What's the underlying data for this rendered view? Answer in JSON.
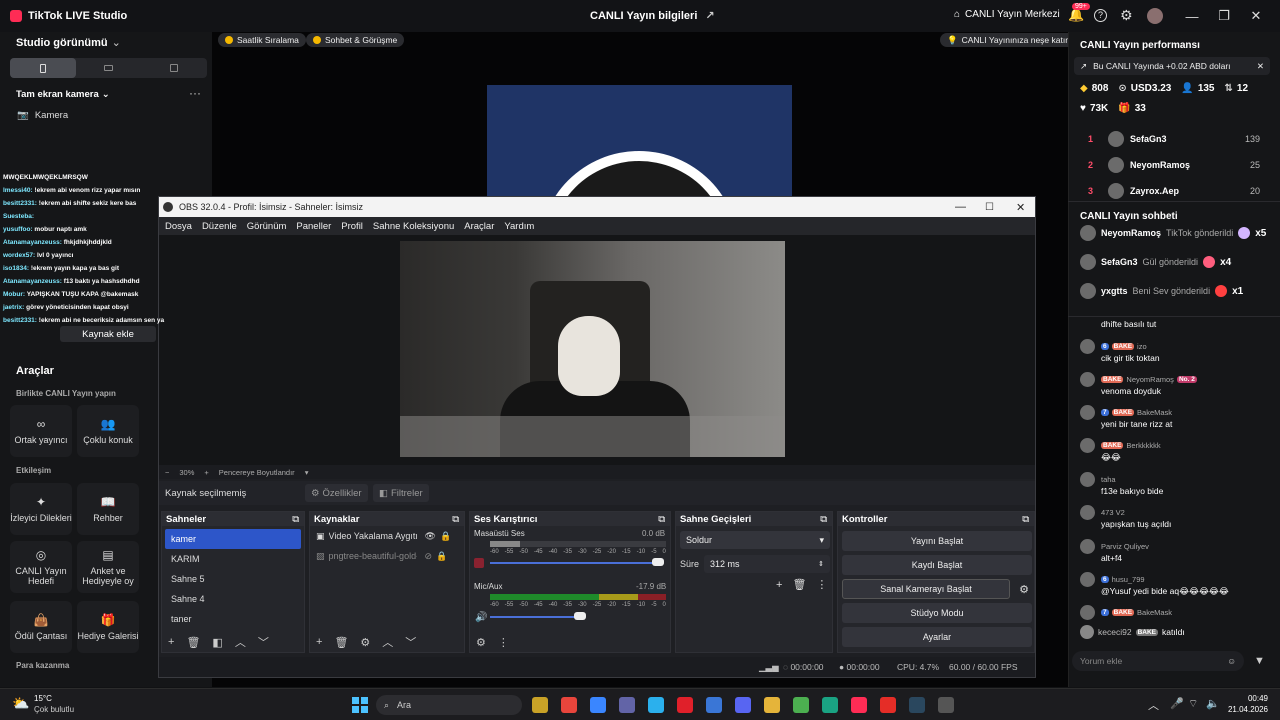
{
  "tiktok": {
    "app_title": "TikTok LIVE Studio",
    "center_title": "CANLI Yayın bilgileri",
    "live_center": "CANLI Yayın Merkezi",
    "notif_count": "99+"
  },
  "left_panel": {
    "studio_view": "Studio görünümü",
    "fullscreen_camera": "Tam ekran kamera",
    "camera": "Kamera",
    "add_source": "Kaynak ekle",
    "tools_title": "Araçlar",
    "together_live": "Birlikte CANLI Yayın yapın",
    "cohost": "Ortak yayıncı",
    "multi_guest": "Çoklu konuk",
    "interaction": "Etkileşim",
    "liked_viewers": "İzleyici Dilekleri",
    "guide": "Rehber",
    "live_goal": "CANLI Yayın Hedefi",
    "poll_wishlist": "Anket ve Hediyeyle oy",
    "reward_bag": "Ödül Çantası",
    "gift_gallery": "Hediye Galerisi",
    "monetization": "Para kazanma",
    "chat_overlay": [
      {
        "user": "",
        "text": "MWQEKLMWQEKLMRSQW"
      },
      {
        "user": "lmessi40:",
        "text": "!ekrem abi venom rizz yapar mısın"
      },
      {
        "user": "besitt2331:",
        "text": "!ekrem abi shifte sekiz kere bas"
      },
      {
        "user": "Suesteba:",
        "text": ""
      },
      {
        "user": "yusuffoo:",
        "text": "mobur naptı amk"
      },
      {
        "user": "Atanamayanzeuss:",
        "text": "fhkjdhkjhddjkld"
      },
      {
        "user": "wordex57:",
        "text": "lvl 0 yayıncı"
      },
      {
        "user": "iso1834:",
        "text": "!ekrem yayın kapa ya bas git"
      },
      {
        "user": "Atanamayanzeuss:",
        "text": "f13 baktı ya hashsdhdhd"
      },
      {
        "user": "Mobur:",
        "text": "YAPIŞKAN TUŞU KAPA @bakemask"
      },
      {
        "user": "jaetrix:",
        "text": "görev yöneticisinden kapat obsyi"
      },
      {
        "user": "besitt2331:",
        "text": "!ekrem abi ne beceriksiz adamsın sen ya"
      }
    ]
  },
  "stage": {
    "pill1": "Saatlik Sıralama",
    "pill2": "Sohbet & Görüşme",
    "pill3": "CANLI Yayınınıza neşe katın"
  },
  "right_panel": {
    "performance_title": "CANLI Yayın performansı",
    "earning_banner": "Bu CANLI Yayında +0.02 ABD doları",
    "stats": {
      "diamonds": "808",
      "usd": "USD3.23",
      "viewers": "135",
      "rank": "12",
      "likes": "73K",
      "gifts": "33"
    },
    "ranking": [
      {
        "n": "1",
        "name": "SefaGn3",
        "score": "139"
      },
      {
        "n": "2",
        "name": "NeyomRamoş",
        "score": "25"
      },
      {
        "n": "3",
        "name": "Zayrox.Aep",
        "score": "20"
      }
    ],
    "chat_title": "CANLI Yayın sohbeti",
    "gifts": [
      {
        "user": "NeyomRamoş",
        "action": "TikTok gönderildi",
        "count": "x5"
      },
      {
        "user": "SefaGn3",
        "action": "Gül gönderildi",
        "count": "x4"
      },
      {
        "user": "yxgtts",
        "action": "Beni Sev gönderildi",
        "count": "x1"
      }
    ],
    "messages": [
      {
        "meta_user": "",
        "badge": "",
        "badge_label": "",
        "text": "dhifte basılı tut"
      },
      {
        "meta_user": "izo",
        "badge": "6",
        "badge_label": "BAKE",
        "text": "cik gir tik toktan"
      },
      {
        "meta_user": "NeyomRamoş",
        "badge": "",
        "badge_label": "BAKE",
        "extra": "No. 2",
        "text": "venoma doyduk"
      },
      {
        "meta_user": "BakeMask",
        "badge": "7",
        "badge_label": "BAKE",
        "text": "yeni bir tane rizz at"
      },
      {
        "meta_user": "Berkkkkkk",
        "badge": "",
        "badge_label": "BAKE",
        "text": "😂😂"
      },
      {
        "meta_user": "taha",
        "badge": "",
        "badge_label": "",
        "text": "f13e bakıyo bide"
      },
      {
        "meta_user": "473 V2",
        "badge": "",
        "badge_label": "",
        "text": "yapışkan tuş açıldı"
      },
      {
        "meta_user": "Parviz Quliyev",
        "badge": "",
        "badge_label": "",
        "text": "alt+f4"
      },
      {
        "meta_user": "husu_799",
        "badge": "6",
        "badge_label": "",
        "text": "@Yusuf yedi bide aq😂😂😂😂😂"
      },
      {
        "meta_user": "BakeMask",
        "badge": "7",
        "badge_label": "BAKE",
        "text": ""
      }
    ],
    "join_user": "kececi92",
    "join_badge": "BAKE",
    "join_text": "katıldı",
    "comment_placeholder": "Yorum ekle"
  },
  "obs": {
    "title": "OBS 32.0.4 - Profil: İsimsiz - Sahneler: İsimsiz",
    "menu": [
      "Dosya",
      "Düzenle",
      "Görünüm",
      "Paneller",
      "Profil",
      "Sahne Koleksiyonu",
      "Araçlar",
      "Yardım"
    ],
    "zoom": "30%",
    "fit": "Pencereye Boyutlandır",
    "no_source": "Kaynak seçilmemiş",
    "properties": "Özellikler",
    "filters": "Filtreler",
    "scenes_title": "Sahneler",
    "scenes": [
      "kamer",
      "KARIM",
      "Sahne 5",
      "Sahne 4",
      "taner"
    ],
    "sources_title": "Kaynaklar",
    "sources": [
      "Video Yakalama Aygıtı",
      "pngtree-beautiful-gold-"
    ],
    "mixer_title": "Ses Karıştırıcı",
    "desktop_audio": "Masaüstü Ses",
    "desktop_db": "0.0 dB",
    "mic_aux": "Mic/Aux",
    "mic_db": "-17.9 dB",
    "meter_ticks": [
      "-60",
      "-55",
      "-50",
      "-45",
      "-40",
      "-35",
      "-30",
      "-25",
      "-20",
      "-15",
      "-10",
      "-5",
      "0"
    ],
    "transitions_title": "Sahne Geçişleri",
    "transition": "Soldur",
    "duration_label": "Süre",
    "duration": "312 ms",
    "controls_title": "Kontroller",
    "controls": [
      "Yayını Başlat",
      "Kaydı Başlat",
      "Sanal Kamerayı Başlat",
      "Stüdyo Modu",
      "Ayarlar"
    ],
    "status": {
      "t1": "00:00:00",
      "t2": "00:00:00",
      "cpu": "CPU: 4.7%",
      "fps": "60.00 / 60.00 FPS"
    }
  },
  "taskbar": {
    "weather_temp": "15°C",
    "weather_desc": "Çok bulutlu",
    "search": "Ara",
    "time": "00:49",
    "date": "21.04.2026"
  }
}
